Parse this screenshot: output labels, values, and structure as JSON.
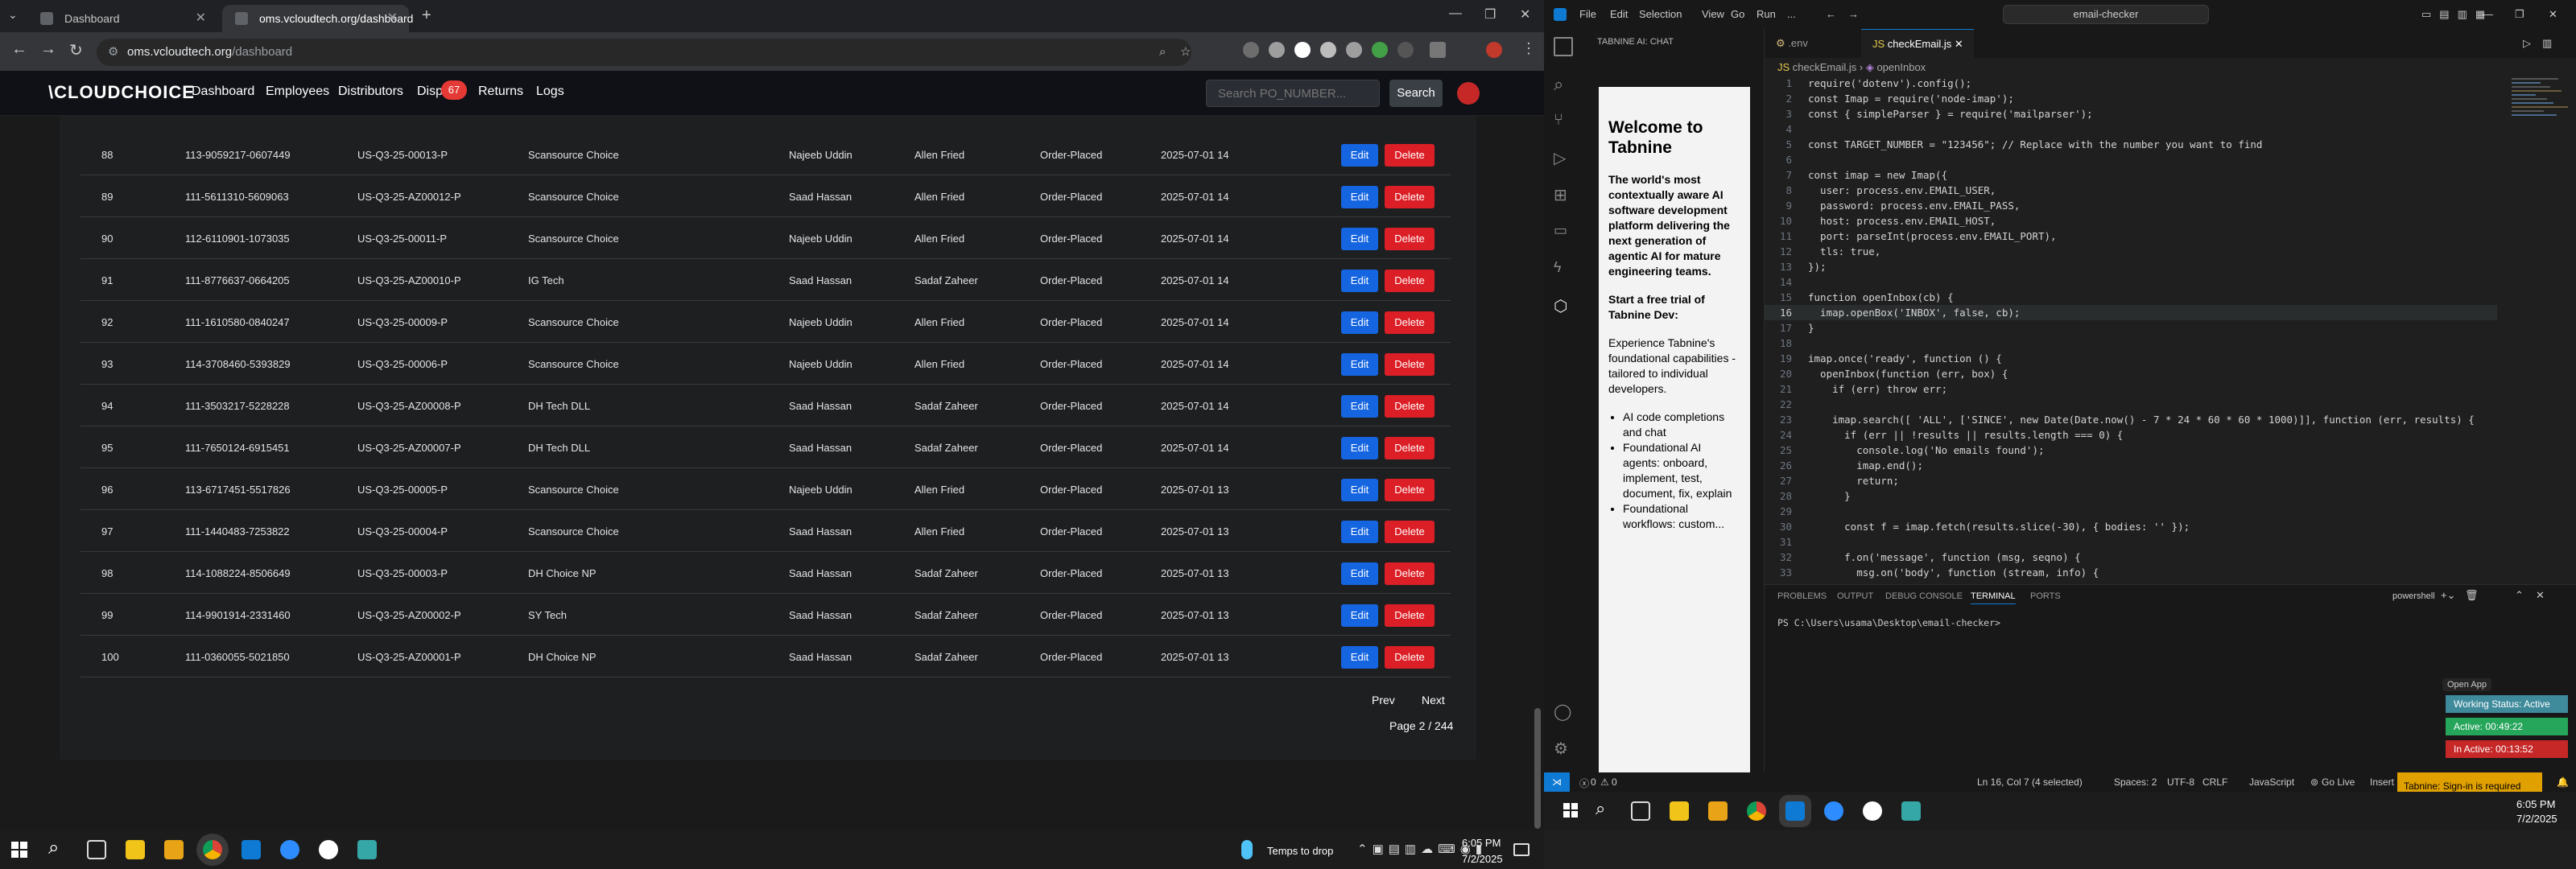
{
  "browser": {
    "tabs": [
      "Dashboard",
      "oms.vcloudtech.org/dashboard"
    ],
    "url_domain": "oms.vcloudtech.org",
    "url_path": "/dashboard"
  },
  "app": {
    "logo": "\\CLOUDCHOICE",
    "nav": [
      "Dashboard",
      "Employees",
      "Distributors",
      "Dispu",
      "Returns",
      "Logs"
    ],
    "disputes_badge": "67",
    "search_placeholder": "Search PO_NUMBER...",
    "search_button": "Search",
    "edit_label": "Edit",
    "delete_label": "Delete",
    "rows": [
      {
        "no": "88",
        "po": "113-9059217-0607449",
        "code": "US-Q3-25-00013-P",
        "dist": "Scansource Choice",
        "emp": "Najeeb Uddin",
        "mgr": "Allen Fried",
        "status": "Order-Placed",
        "date": "2025-07-01 14"
      },
      {
        "no": "89",
        "po": "111-5611310-5609063",
        "code": "US-Q3-25-AZ00012-P",
        "dist": "Scansource Choice",
        "emp": "Saad Hassan",
        "mgr": "Allen Fried",
        "status": "Order-Placed",
        "date": "2025-07-01 14"
      },
      {
        "no": "90",
        "po": "112-6110901-1073035",
        "code": "US-Q3-25-00011-P",
        "dist": "Scansource Choice",
        "emp": "Najeeb Uddin",
        "mgr": "Allen Fried",
        "status": "Order-Placed",
        "date": "2025-07-01 14"
      },
      {
        "no": "91",
        "po": "111-8776637-0664205",
        "code": "US-Q3-25-AZ00010-P",
        "dist": "IG Tech",
        "emp": "Saad Hassan",
        "mgr": "Sadaf Zaheer",
        "status": "Order-Placed",
        "date": "2025-07-01 14"
      },
      {
        "no": "92",
        "po": "111-1610580-0840247",
        "code": "US-Q3-25-00009-P",
        "dist": "Scansource Choice",
        "emp": "Najeeb Uddin",
        "mgr": "Allen Fried",
        "status": "Order-Placed",
        "date": "2025-07-01 14"
      },
      {
        "no": "93",
        "po": "114-3708460-5393829",
        "code": "US-Q3-25-00006-P",
        "dist": "Scansource Choice",
        "emp": "Najeeb Uddin",
        "mgr": "Allen Fried",
        "status": "Order-Placed",
        "date": "2025-07-01 14"
      },
      {
        "no": "94",
        "po": "111-3503217-5228228",
        "code": "US-Q3-25-AZ00008-P",
        "dist": "DH Tech DLL",
        "emp": "Saad Hassan",
        "mgr": "Sadaf Zaheer",
        "status": "Order-Placed",
        "date": "2025-07-01 14"
      },
      {
        "no": "95",
        "po": "111-7650124-6915451",
        "code": "US-Q3-25-AZ00007-P",
        "dist": "DH Tech DLL",
        "emp": "Saad Hassan",
        "mgr": "Sadaf Zaheer",
        "status": "Order-Placed",
        "date": "2025-07-01 14"
      },
      {
        "no": "96",
        "po": "113-6717451-5517826",
        "code": "US-Q3-25-00005-P",
        "dist": "Scansource Choice",
        "emp": "Najeeb Uddin",
        "mgr": "Allen Fried",
        "status": "Order-Placed",
        "date": "2025-07-01 13"
      },
      {
        "no": "97",
        "po": "111-1440483-7253822",
        "code": "US-Q3-25-00004-P",
        "dist": "Scansource Choice",
        "emp": "Saad Hassan",
        "mgr": "Allen Fried",
        "status": "Order-Placed",
        "date": "2025-07-01 13"
      },
      {
        "no": "98",
        "po": "114-1088224-8506649",
        "code": "US-Q3-25-00003-P",
        "dist": "DH Choice NP",
        "emp": "Saad Hassan",
        "mgr": "Sadaf Zaheer",
        "status": "Order-Placed",
        "date": "2025-07-01 13"
      },
      {
        "no": "99",
        "po": "114-9901914-2331460",
        "code": "US-Q3-25-AZ00002-P",
        "dist": "SY Tech",
        "emp": "Saad Hassan",
        "mgr": "Sadaf Zaheer",
        "status": "Order-Placed",
        "date": "2025-07-01 13"
      },
      {
        "no": "100",
        "po": "111-0360055-5021850",
        "code": "US-Q3-25-AZ00001-P",
        "dist": "DH Choice NP",
        "emp": "Saad Hassan",
        "mgr": "Sadaf Zaheer",
        "status": "Order-Placed",
        "date": "2025-07-01 13"
      }
    ],
    "prev": "Prev",
    "next": "Next",
    "page_info": "Page 2 / 244"
  },
  "taskbar_left": {
    "temp": "Temps to drop",
    "time": "6:05 PM",
    "date": "7/2/2025"
  },
  "vscode": {
    "menu": [
      "File",
      "Edit",
      "Selection",
      "View",
      "Go",
      "Run",
      "..."
    ],
    "command_center": "email-checker",
    "side_header": "TABNINE AI: CHAT",
    "tabnine": {
      "title": "Welcome to Tabnine",
      "intro": "The world's most contextually aware AI software development platform delivering the next generation of agentic AI for mature engineering teams.",
      "cta": "Start a free trial of Tabnine Dev:",
      "desc": "Experience Tabnine's foundational capabilities - tailored to individual developers.",
      "bullets": [
        "AI code completions and chat",
        "Foundational AI agents: onboard, implement, test, document, fix, explain",
        "Foundational workflows: custom..."
      ]
    },
    "tabs": [
      ".env",
      "checkEmail.js"
    ],
    "breadcrumb": [
      "checkEmail.js",
      "openInbox"
    ],
    "code": [
      "require('dotenv').config();",
      "const Imap = require('node-imap');",
      "const { simpleParser } = require('mailparser');",
      "",
      "const TARGET_NUMBER = \"123456\"; // Replace with the number you want to find",
      "",
      "const imap = new Imap({",
      "  user: process.env.EMAIL_USER,",
      "  password: process.env.EMAIL_PASS,",
      "  host: process.env.EMAIL_HOST,",
      "  port: parseInt(process.env.EMAIL_PORT),",
      "  tls: true,",
      "});",
      "",
      "function openInbox(cb) {",
      "  imap.openBox('INBOX', false, cb);",
      "}",
      "",
      "imap.once('ready', function () {",
      "  openInbox(function (err, box) {",
      "    if (err) throw err;",
      "",
      "    imap.search([ 'ALL', ['SINCE', new Date(Date.now() - 7 * 24 * 60 * 60 * 1000)]], function (err, results) {",
      "      if (err || !results || results.length === 0) {",
      "        console.log('No emails found');",
      "        imap.end();",
      "        return;",
      "      }",
      "",
      "      const f = imap.fetch(results.slice(-30), { bodies: '' });",
      "",
      "      f.on('message', function (msg, seqno) {",
      "        msg.on('body', function (stream, info) {"
    ],
    "panel_tabs": [
      "PROBLEMS",
      "OUTPUT",
      "DEBUG CONSOLE",
      "TERMINAL",
      "PORTS"
    ],
    "shell": "powershell",
    "prompt": "PS C:\\Users\\usama\\Desktop\\email-checker>",
    "open_app": "Open App",
    "working_status": "Working Status: Active",
    "active_time": "Active: 00:49:22",
    "inactive_time": "In Active: 00:13:52",
    "status": {
      "errors": "0",
      "warnings": "0",
      "position": "Ln 16, Col 7 (4 selected)",
      "spaces": "Spaces: 2",
      "encoding": "UTF-8",
      "eol": "CRLF",
      "lang": "JavaScript",
      "golive": "Go Live",
      "mode": "Insert",
      "tabnine": "Tabnine: Sign-in is required"
    }
  },
  "taskbar_right": {
    "time": "6:05 PM",
    "date": "7/2/2025"
  },
  "colors": {
    "edit": "#1565e0",
    "delete": "#dc1f26",
    "badge": "#e53935",
    "working": "#3f8b9c",
    "active": "#26a65b",
    "inactive": "#c62828",
    "tabnine_bar": "#e0a000"
  }
}
